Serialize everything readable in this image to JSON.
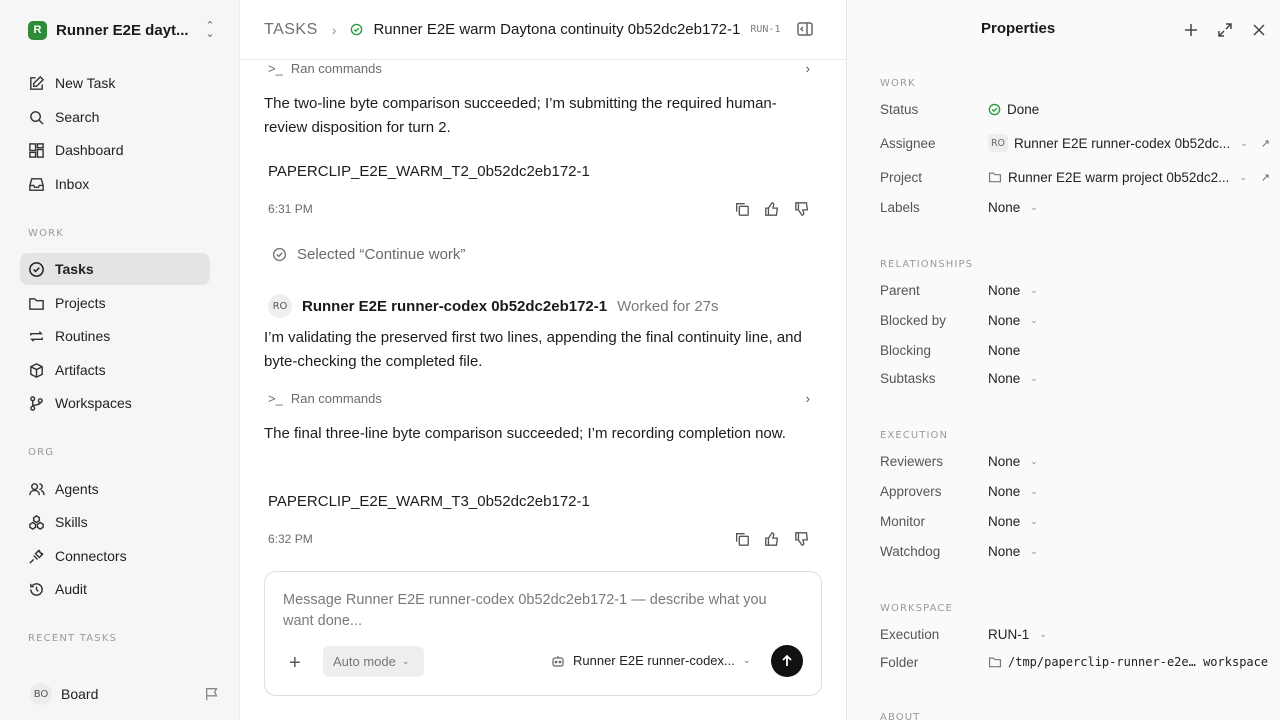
{
  "workspace": {
    "logo_letter": "R",
    "name": "Runner E2E dayt..."
  },
  "nav": {
    "new_task": "New Task",
    "search": "Search",
    "dashboard": "Dashboard",
    "inbox": "Inbox",
    "work_label": "WORK",
    "tasks": "Tasks",
    "projects": "Projects",
    "routines": "Routines",
    "artifacts": "Artifacts",
    "workspaces": "Workspaces",
    "org_label": "ORG",
    "agents": "Agents",
    "skills": "Skills",
    "connectors": "Connectors",
    "audit": "Audit",
    "recent_label": "RECENT TASKS"
  },
  "board": {
    "initials": "BO",
    "name": "Board"
  },
  "breadcrumb": {
    "root": "TASKS",
    "title": "Runner E2E warm Daytona continuity 0b52dc2eb172-1",
    "run": "RUN-1"
  },
  "thread": {
    "ran_commands_1": "Ran commands",
    "msg1": "The two-line byte comparison succeeded; I’m submitting the required human-review disposition for turn 2.",
    "code1": "PAPERCLIP_E2E_WARM_T2_0b52dc2eb172-1",
    "time1": "6:31 PM",
    "selected": "Selected “Continue work”",
    "author_initials": "RO",
    "author_name": "Runner E2E runner-codex 0b52dc2eb172-1",
    "worked": "Worked for 27s",
    "msg2": "I’m validating the preserved first two lines, appending the final continuity line, and byte-checking the completed file.",
    "ran_commands_2": "Ran commands",
    "msg3": "The final three-line byte comparison succeeded; I’m recording completion now.",
    "code2": "PAPERCLIP_E2E_WARM_T3_0b52dc2eb172-1",
    "time2": "6:32 PM"
  },
  "composer": {
    "placeholder": "Message Runner E2E runner-codex 0b52dc2eb172-1 — describe what you want done...",
    "mode": "Auto mode",
    "agent": "Runner E2E runner-codex..."
  },
  "properties": {
    "title": "Properties",
    "work_label": "WORK",
    "status_k": "Status",
    "status_v": "Done",
    "assignee_k": "Assignee",
    "assignee_initials": "RO",
    "assignee_v": "Runner E2E runner-codex 0b52dc...",
    "project_k": "Project",
    "project_v": "Runner E2E warm project 0b52dc2...",
    "labels_k": "Labels",
    "labels_v": "None",
    "rel_label": "RELATIONSHIPS",
    "parent_k": "Parent",
    "parent_v": "None",
    "blockedby_k": "Blocked by",
    "blockedby_v": "None",
    "blocking_k": "Blocking",
    "blocking_v": "None",
    "subtasks_k": "Subtasks",
    "subtasks_v": "None",
    "exec_label": "EXECUTION",
    "reviewers_k": "Reviewers",
    "reviewers_v": "None",
    "approvers_k": "Approvers",
    "approvers_v": "None",
    "monitor_k": "Monitor",
    "monitor_v": "None",
    "watchdog_k": "Watchdog",
    "watchdog_v": "None",
    "ws_label": "WORKSPACE",
    "execution_k": "Execution",
    "execution_v": "RUN-1",
    "folder_k": "Folder",
    "folder_v": "/tmp/paperclip-runner-e2e… workspace",
    "about_label": "ABOUT"
  },
  "colors": {
    "done_green": "#2e9e44",
    "brand_green": "#2e8b3a"
  }
}
